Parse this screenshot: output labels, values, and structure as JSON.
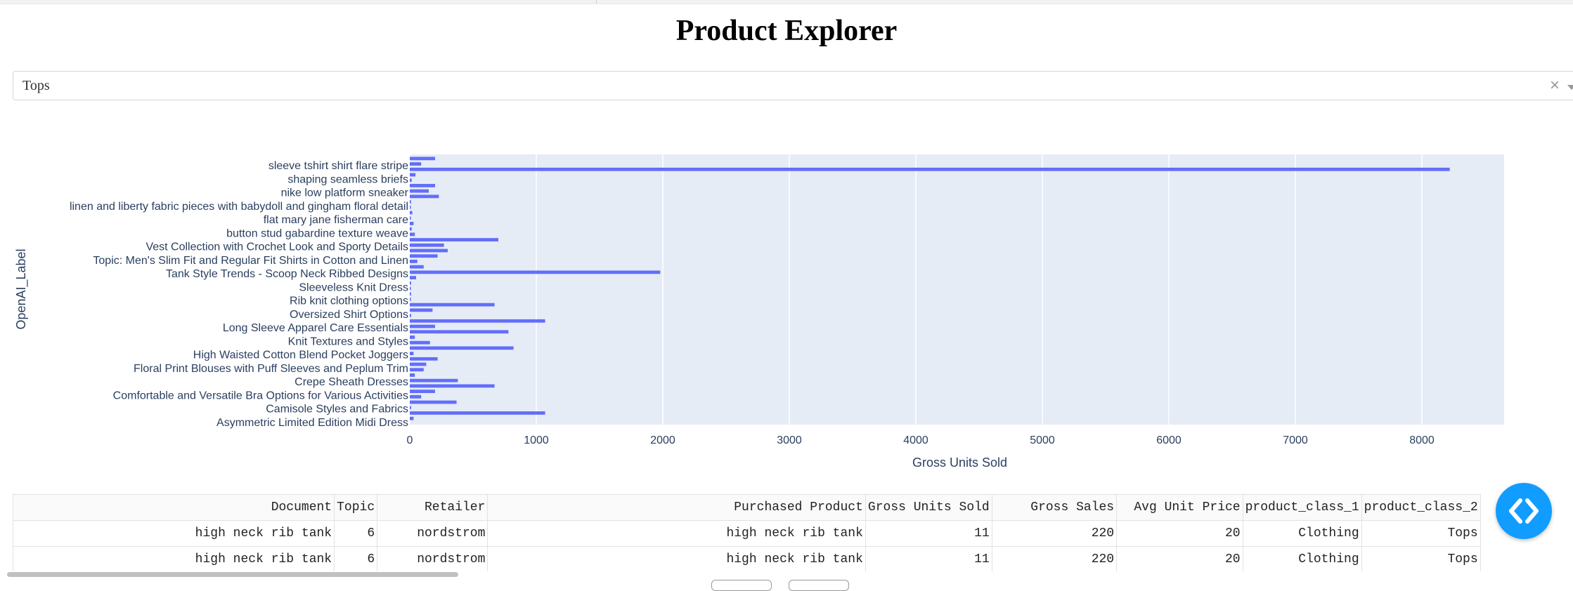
{
  "page": {
    "title": "Product Explorer"
  },
  "filter": {
    "selected": "Tops",
    "clear_symbol": "×"
  },
  "chart_data": {
    "type": "bar",
    "orientation": "horizontal",
    "xlabel": "Gross Units Sold",
    "ylabel": "OpenAI_Label",
    "xlim": [
      0,
      8650
    ],
    "xticks": [
      0,
      1000,
      2000,
      3000,
      4000,
      5000,
      6000,
      7000,
      8000
    ],
    "grid": true,
    "labeled_categories": [
      "sleeve tshirt shirt flare stripe",
      "shaping seamless briefs",
      "nike low platform sneaker",
      "linen and liberty fabric pieces with babydoll and gingham floral detail",
      "flat mary jane fisherman care",
      "button stud gabardine texture weave",
      "Vest Collection with Crochet Look and Sporty Details",
      "Topic: Men's Slim Fit and Regular Fit Shirts in Cotton and Linen",
      "Tank Style Trends - Scoop Neck Ribbed Designs",
      "Sleeveless Knit Dress",
      "Rib knit clothing options",
      "Oversized Shirt Options",
      "Long Sleeve Apparel Care Essentials",
      "Knit Textures and Styles",
      "High Waisted Cotton Blend Pocket Joggers",
      "Floral Print Blouses with Puff Sleeves and Peplum Trim",
      "Crepe Sheath Dresses",
      "Comfortable and Versatile Bra Options for Various Activities",
      "Camisole Styles and Fabrics",
      "Asymmetric Limited Edition Midi Dress"
    ],
    "values_top_to_bottom": [
      200,
      90,
      8220,
      45,
      15,
      200,
      150,
      230,
      10,
      8,
      20,
      8,
      30,
      15,
      40,
      700,
      270,
      300,
      220,
      60,
      110,
      1980,
      50,
      10,
      8,
      10,
      5,
      670,
      180,
      10,
      1070,
      200,
      780,
      40,
      160,
      820,
      30,
      220,
      130,
      110,
      40,
      380,
      670,
      200,
      90,
      370,
      10,
      1070,
      30
    ],
    "bar_color": "#636efa",
    "plot_bg": "#e5ecf6"
  },
  "table": {
    "columns": [
      "Document",
      "Topic",
      "Retailer",
      "Purchased Product",
      "Gross Units Sold",
      "Gross Sales",
      "Avg Unit Price",
      "product_class_1",
      "product_class_2"
    ],
    "rows": [
      [
        "high neck rib tank",
        "6",
        "nordstrom",
        "high neck rib tank",
        "11",
        "220",
        "20",
        "Clothing",
        "Tops"
      ],
      [
        "high neck rib tank",
        "6",
        "nordstrom",
        "high neck rib tank",
        "11",
        "220",
        "20",
        "Clothing",
        "Tops"
      ]
    ]
  },
  "icons": {
    "fab": "code-brackets-icon",
    "clear": "clear-icon",
    "caret": "chevron-down-icon"
  },
  "colors": {
    "fab": "#119dff",
    "title": "#000000"
  }
}
